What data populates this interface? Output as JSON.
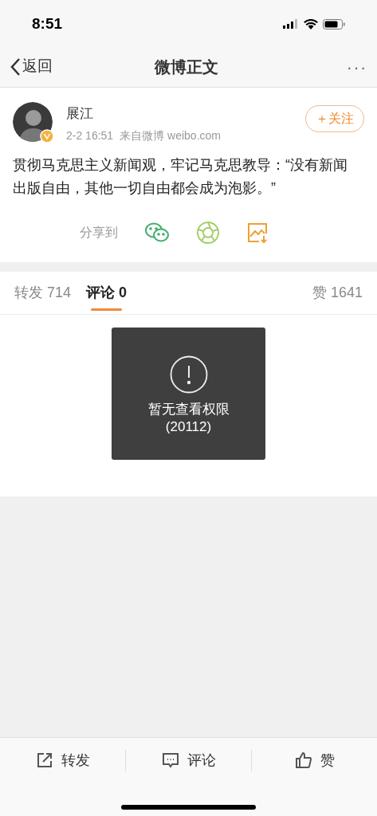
{
  "status_bar": {
    "time": "8:51"
  },
  "nav": {
    "back": "返回",
    "title": "微博正文",
    "more": "···"
  },
  "post": {
    "author": "展江",
    "verified": true,
    "time": "2-2 16:51",
    "source": "来自微博 weibo.com",
    "follow": "＋关注",
    "text": "贯彻马克思主义新闻观，牢记马克思教导：“没有新闻出版自由，其他一切自由都会成为泡影。”"
  },
  "share": {
    "label": "分享到",
    "targets": [
      {
        "kind": "wechat"
      },
      {
        "kind": "moments"
      },
      {
        "kind": "image"
      }
    ]
  },
  "tabs": [
    {
      "label": "转发 714",
      "selected": false
    },
    {
      "label": "评论 0",
      "selected": true
    }
  ],
  "likes_tab": "赞 1641",
  "toast": {
    "message": "暂无查看权限",
    "code": "(20112)"
  },
  "actions": [
    {
      "kind": "repost",
      "label": "转发"
    },
    {
      "kind": "comment",
      "label": "评论"
    },
    {
      "kind": "like",
      "label": "赞"
    }
  ]
}
